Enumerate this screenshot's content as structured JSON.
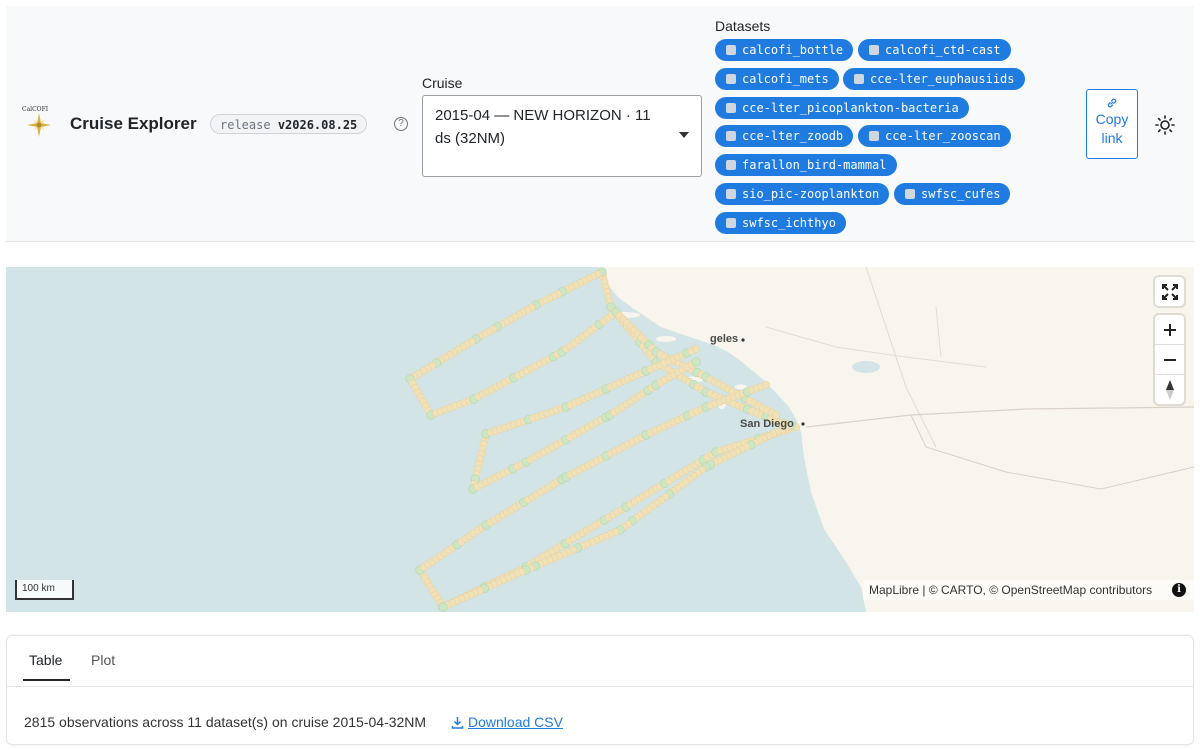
{
  "header": {
    "logo_text": "CalCOFI",
    "app_title": "Cruise Explorer",
    "release_label": "release",
    "release_version": "v2026.08.25",
    "help_icon": "question-circle-icon",
    "cruise_label": "Cruise",
    "cruise_value": "2015-04 — NEW HORIZON · 11 ds (32NM)",
    "datasets_label": "Datasets",
    "datasets": [
      "calcofi_bottle",
      "calcofi_ctd-cast",
      "calcofi_mets",
      "cce-lter_euphausiids",
      "cce-lter_picoplankton-bacteria",
      "cce-lter_zoodb",
      "cce-lter_zooscan",
      "farallon_bird-mammal",
      "sio_pic-zooplankton",
      "swfsc_cufes",
      "swfsc_ichthyo"
    ],
    "copy_link_label": "Copy link",
    "theme_icon": "sun-icon"
  },
  "map": {
    "place_labels": [
      "geles",
      "San Diego"
    ],
    "scale_label": "100 km",
    "attribution": "MapLibre | © CARTO, © OpenStreetMap contributors",
    "colors": {
      "water": "#d3e4e6",
      "land": "#f8f5ee",
      "track": "#f1e1b8",
      "station": "#cde6c3",
      "station_stroke": "#b7d6ab"
    }
  },
  "results": {
    "tabs": [
      "Table",
      "Plot"
    ],
    "active_tab": "Table",
    "summary": "2815 observations across 11 dataset(s) on cruise 2015-04-32NM",
    "download_label": "Download CSV"
  }
}
